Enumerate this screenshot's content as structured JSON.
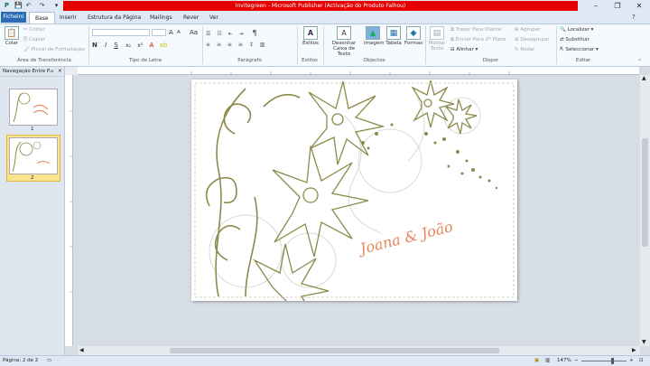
{
  "window": {
    "title": "Invitegreen  -  Microsoft Publisher (Activação do Produto Falhou)",
    "minimize": "–",
    "maximize": "❐",
    "close": "✕"
  },
  "qat": {
    "save": "💾",
    "undo": "↶",
    "redo": "↷"
  },
  "tabs": {
    "file": "Ficheiro",
    "home": "Base",
    "insert": "Inserir",
    "page_design": "Estrutura da Página",
    "mailings": "Mailings",
    "review": "Rever",
    "view": "Ver"
  },
  "ribbon": {
    "clipboard": {
      "paste": "Colar",
      "cut": "Cortar",
      "copy": "Copiar",
      "format_painter": "Pincel de Formatação",
      "label": "Área de Transferência"
    },
    "font": {
      "bold": "N",
      "italic": "I",
      "underline": "S",
      "subscript": "x₂",
      "superscript": "x²",
      "change_case": "Aa",
      "grow": "A",
      "shrink": "A",
      "label": "Tipo de Letra"
    },
    "paragraph": {
      "pilcrow": "¶",
      "label": "Parágrafo"
    },
    "styles": {
      "styles": "Estilos",
      "label": "Estilos"
    },
    "objects": {
      "draw_text_box": "Desenhar Caixa de Texto",
      "picture": "Imagem",
      "table": "Tabela",
      "shapes": "Formas",
      "label": "Objectos"
    },
    "arrange": {
      "wrap_text": "Moldar Texto",
      "bring_forward": "Trazer Para Diante",
      "send_backward": "Enviar Para 2º Plano",
      "align": "Alinhar",
      "group": "Agrupar",
      "ungroup": "Desagrupar",
      "rotate": "Rodar",
      "label": "Dispor"
    },
    "editing": {
      "find": "Localizar",
      "replace": "Substituir",
      "select": "Seleccionar",
      "label": "Editar"
    }
  },
  "nav": {
    "title": "Navegação Entre P...",
    "collapse": "«",
    "close": "✕",
    "pages": [
      {
        "number": "1"
      },
      {
        "number": "2"
      }
    ]
  },
  "page": {
    "names": "Joana & João"
  },
  "status": {
    "page": "Página: 2 de 2",
    "zoom": "147%",
    "minus": "−",
    "plus": "+"
  },
  "colors": {
    "accent": "#2a6db5",
    "title_red": "#e60000",
    "flourish": "#8c8a4a",
    "script": "#e8835a"
  }
}
